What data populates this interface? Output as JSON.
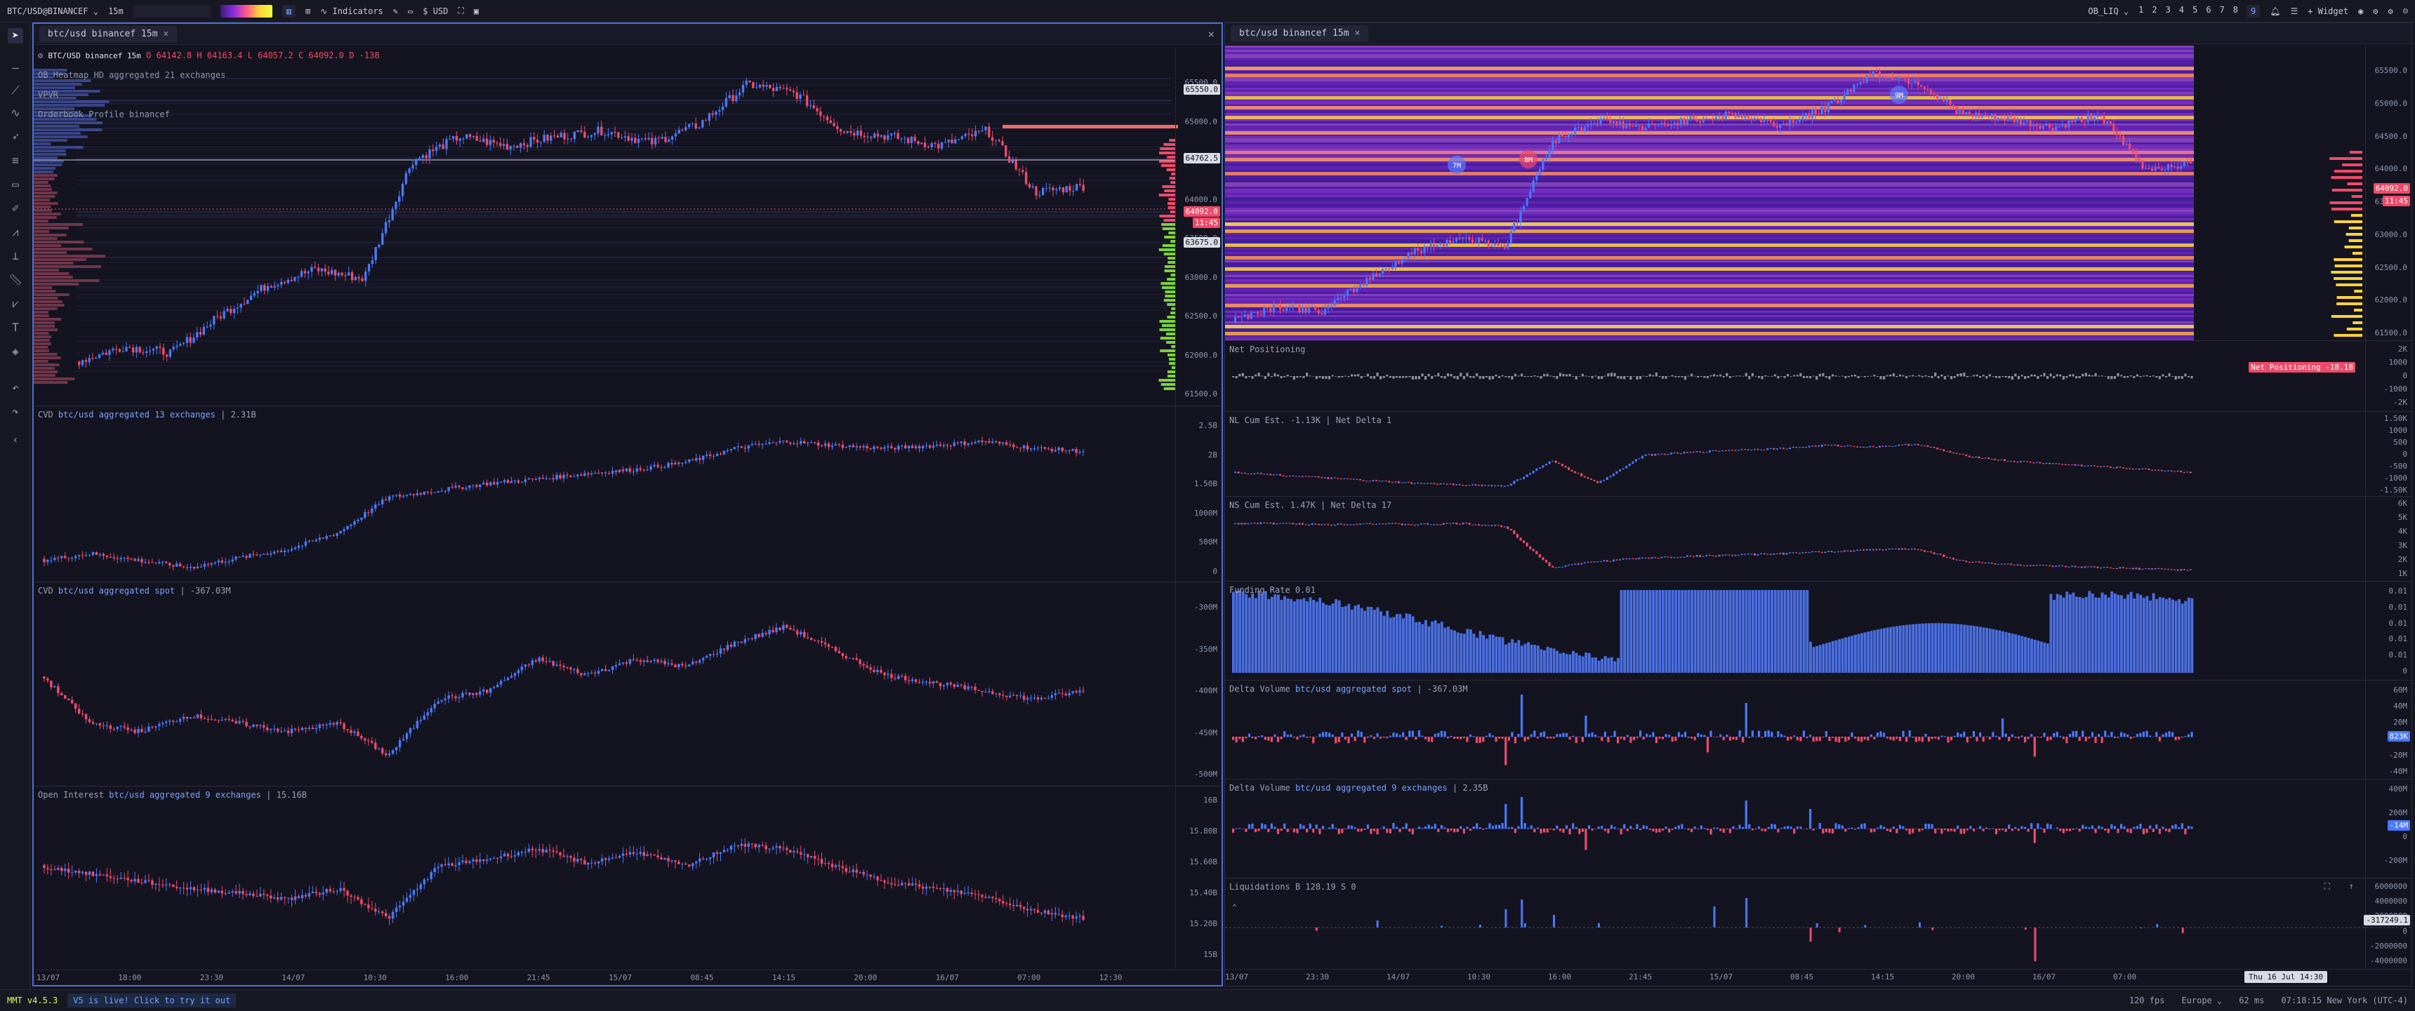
{
  "topbar": {
    "symbol": "BTC/USD@BINANCEF",
    "timeframe": "15m",
    "indicators": "Indicators",
    "currency": "USD",
    "ob_liq": "OB_LIQ",
    "layouts": [
      "1",
      "2",
      "3",
      "4",
      "5",
      "6",
      "7",
      "8",
      "9"
    ],
    "widget": "+ Widget"
  },
  "left_window": {
    "tab": "btc/usd binancef 15m",
    "header": {
      "symbol": "BTC/USD binancef 15m",
      "o": "O 64142.8",
      "h": "H 64163.4",
      "l": "L 64057.2",
      "c": "C 64092.0",
      "d": "D -138"
    },
    "overlays": [
      "OB Heatmap HD aggregated 21 exchanges",
      "VPVR",
      "Orderbook Profile binancef"
    ],
    "price_ticks": [
      "65500.0",
      "65000.0",
      "64500.0",
      "64000.0",
      "63500.0",
      "63000.0",
      "62500.0",
      "62000.0",
      "61500.0"
    ],
    "price_tags": [
      "65550.0",
      "64762.5",
      "64092.0",
      "11:45",
      "63675.0"
    ],
    "cvd1": {
      "title": "CVD",
      "source": "btc/usd aggregated 13 exchanges",
      "value": "2.31B",
      "ticks": [
        "2.5B",
        "2B",
        "1.50B",
        "1000M",
        "500M",
        "0"
      ]
    },
    "cvd2": {
      "title": "CVD",
      "source": "btc/usd aggregated spot",
      "value": "-367.03M",
      "ticks": [
        "-300M",
        "-350M",
        "-400M",
        "-450M",
        "-500M"
      ]
    },
    "oi": {
      "title": "Open Interest",
      "source": "btc/usd aggregated 9 exchanges",
      "value": "15.16B",
      "ticks": [
        "16B",
        "15.80B",
        "15.60B",
        "15.40B",
        "15.20B",
        "15B"
      ]
    },
    "time_labels": [
      "13/07",
      "18:00",
      "23:30",
      "14/07",
      "10:30",
      "16:00",
      "21:45",
      "15/07",
      "08:45",
      "14:15",
      "20:00",
      "16/07",
      "07:00",
      "12:30"
    ]
  },
  "right_window": {
    "tab": "btc/usd binancef 15m",
    "price_ticks": [
      "65500.0",
      "65000.0",
      "64500.0",
      "64000.0",
      "63500.0",
      "63000.0",
      "62500.0",
      "62000.0",
      "61500.0"
    ],
    "price_tags": [
      "64092.0",
      "11:45"
    ],
    "bubbles": [
      "7M",
      "8M",
      "9M"
    ],
    "net_positioning": {
      "title": "Net Positioning",
      "tag": "Net Positioning",
      "tag_value": "-18.18",
      "ticks": [
        "2K",
        "1000",
        "0",
        "-1000",
        "-2K"
      ]
    },
    "nl": {
      "title": "NL Cum Est. -1.13K | Net Delta 1",
      "ticks": [
        "1.50K",
        "1000",
        "500",
        "0",
        "-500",
        "-1000",
        "-1.50K"
      ]
    },
    "ns": {
      "title": "NS Cum Est. 1.47K | Net Delta 17",
      "ticks": [
        "6K",
        "5K",
        "4K",
        "3K",
        "2K",
        "1K"
      ]
    },
    "funding": {
      "title": "Funding Rate 0.01",
      "ticks": [
        "0.01",
        "0.01",
        "0.01",
        "0.01",
        "0.01",
        "0"
      ]
    },
    "dv_spot": {
      "title": "Delta Volume",
      "source": "btc/usd aggregated spot",
      "value": "-367.03M",
      "ticks": [
        "60M",
        "40M",
        "20M",
        "0",
        "-20M",
        "-40M"
      ],
      "tag": "823K"
    },
    "dv_agg": {
      "title": "Delta Volume",
      "source": "btc/usd aggregated 9 exchanges",
      "value": "2.35B",
      "ticks": [
        "400M",
        "200M",
        "0",
        "-200M"
      ],
      "tag": "-14M"
    },
    "liq": {
      "title": "Liquidations",
      "b": "B 128.19",
      "s": "S 0",
      "ticks": [
        "6000000",
        "4000000",
        "2000000",
        "0",
        "-2000000",
        "-4000000"
      ],
      "tag": "-317249.1"
    },
    "time_labels": [
      "13/07",
      "23:30",
      "14/07",
      "10:30",
      "16:00",
      "21:45",
      "15/07",
      "08:45",
      "14:15",
      "20:00",
      "16/07",
      "07:00"
    ],
    "cursor_time": "Thu 16 Jul 14:30"
  },
  "bottombar": {
    "version": "MMT v4.5.3",
    "announcement": "V5 is live! Click to try it out",
    "fps": "120 fps",
    "region": "Europe",
    "latency": "62 ms",
    "clock": "07:18:15 New York (UTC-4)"
  },
  "colors": {
    "accent": "#4d6fd6",
    "bull": "#4a78ff",
    "bear": "#f04a6a",
    "bg": "#14151e"
  }
}
